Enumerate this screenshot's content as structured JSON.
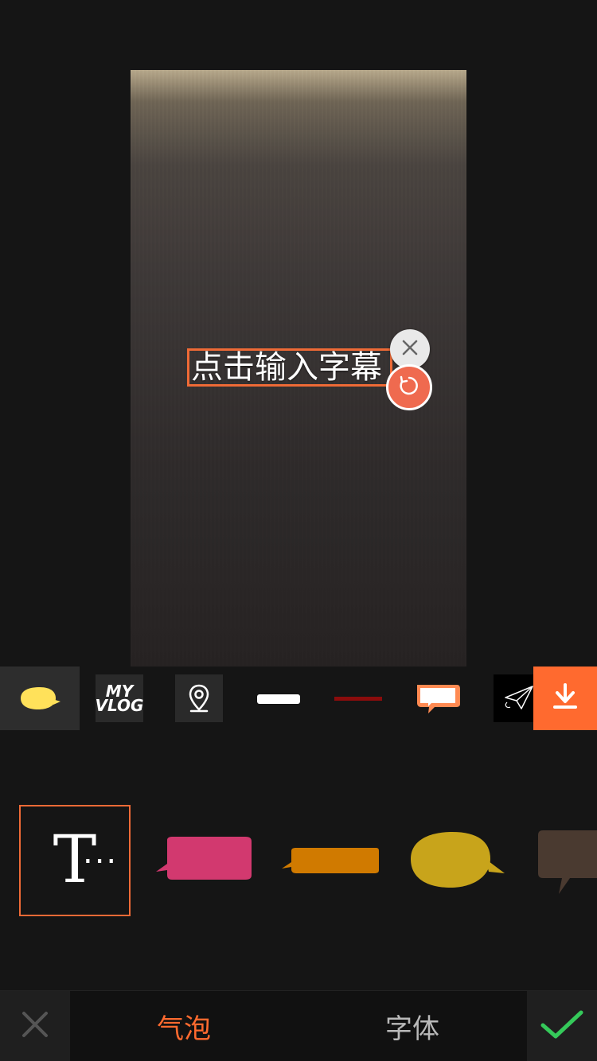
{
  "preview": {
    "caption_placeholder": "点击输入字幕"
  },
  "stickers": [
    {
      "name": "yellow-speech-bubble-sticker",
      "selected": true
    },
    {
      "name": "my-vlog-sticker",
      "label": "MY VLOG"
    },
    {
      "name": "location-pin-sticker"
    },
    {
      "name": "white-bar-sticker"
    },
    {
      "name": "red-line-sticker"
    },
    {
      "name": "orange-speech-bubble-sticker"
    },
    {
      "name": "paper-plane-sticker"
    }
  ],
  "download": {
    "icon": "download-icon"
  },
  "styles": [
    {
      "name": "text-style-default",
      "selected": true,
      "glyph": "T",
      "ellipsis": "..."
    },
    {
      "name": "magenta-bubble-style",
      "color": "#d2396f"
    },
    {
      "name": "orange-bubble-style",
      "color": "#d07a00"
    },
    {
      "name": "yellow-bubble-style",
      "color": "#c8a41b"
    },
    {
      "name": "brown-bubble-style",
      "color": "#4a3a30"
    }
  ],
  "tabs": [
    {
      "label": "气泡",
      "active": true
    },
    {
      "label": "字体",
      "active": false
    }
  ],
  "colors": {
    "accent": "#ff6a2f",
    "confirm": "#35c95a"
  }
}
